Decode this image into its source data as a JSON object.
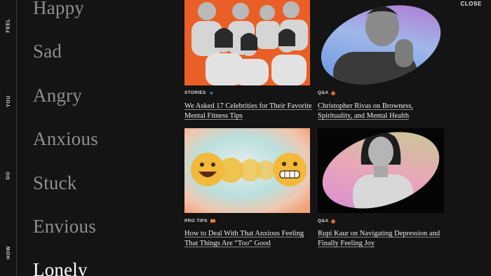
{
  "nav": {
    "tabs": [
      {
        "label": "FEEL"
      },
      {
        "label": "YOU"
      },
      {
        "label": "DO"
      },
      {
        "label": "HOW"
      }
    ]
  },
  "feelings": [
    "Happy",
    "Sad",
    "Angry",
    "Anxious",
    "Stuck",
    "Envious",
    "Lonely"
  ],
  "active_feeling": "Lonely",
  "close_label": "CLOSE",
  "articles": [
    {
      "category": "STORIES",
      "icon": "play-triangle-icon",
      "icon_color": "#3b7bd9",
      "title_line1": "We Asked 17 Celebrities for Their Favorite",
      "title_line2": "Mental Fitness Tips"
    },
    {
      "category": "Q&A",
      "icon": "flame-icon",
      "icon_color": "#e0652b",
      "title_line1": "Christopher Rivas on Browness,",
      "title_line2": "Spirituality, and Mental Health"
    },
    {
      "category": "PRO TIPS",
      "icon": "speech-bubble-icon",
      "icon_color": "#f07a3a",
      "title_line1": "How to Deal With That Anxious Feeling",
      "title_line2": "That Things Are “Too” Good"
    },
    {
      "category": "Q&A",
      "icon": "flame-icon",
      "icon_color": "#e0652b",
      "title_line1": "Rupi Kaur on Navigating Depression and",
      "title_line2": "Finally Feeling Joy"
    }
  ]
}
